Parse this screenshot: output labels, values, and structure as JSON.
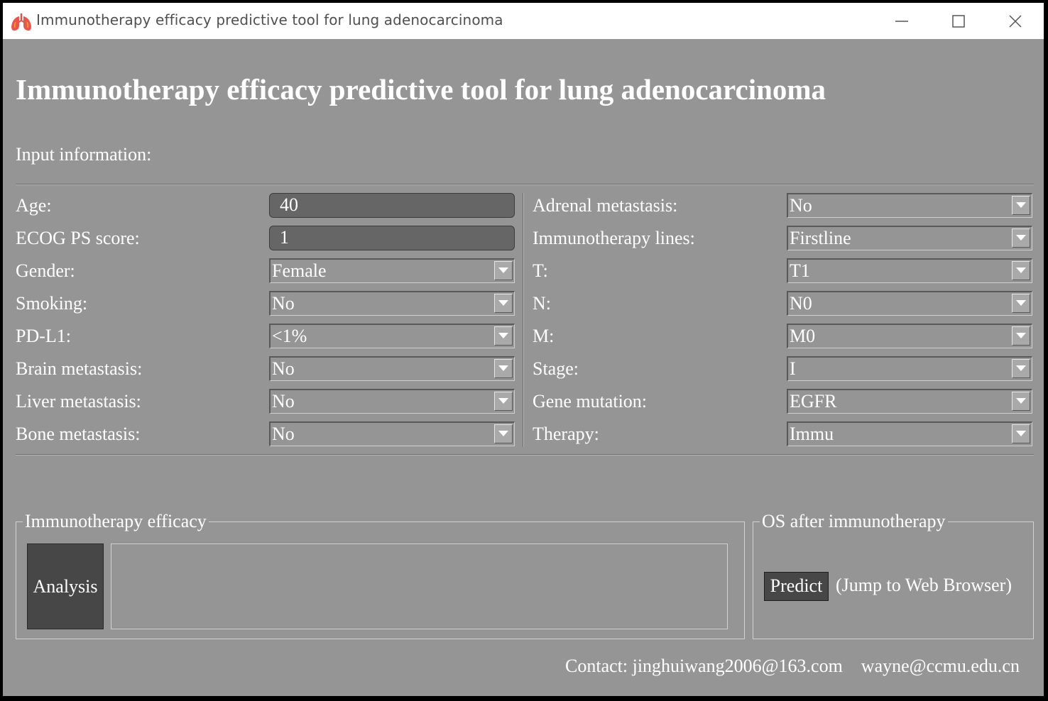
{
  "window": {
    "title": "Immunotherapy efficacy predictive tool for lung adenocarcinoma",
    "icon": "lungs-icon",
    "controls": [
      "minimize-icon",
      "maximize-icon",
      "close-icon"
    ]
  },
  "heading": "Immunotherapy efficacy predictive tool for lung adenocarcinoma",
  "input_section_label": "Input information:",
  "left_fields": [
    {
      "label": "Age:",
      "type": "entry",
      "value": "40"
    },
    {
      "label": "ECOG PS score:",
      "type": "entry",
      "value": "1"
    },
    {
      "label": "Gender:",
      "type": "combo",
      "value": "Female"
    },
    {
      "label": "Smoking:",
      "type": "combo",
      "value": "No"
    },
    {
      "label": "PD-L1:",
      "type": "combo",
      "value": "<1%"
    },
    {
      "label": "Brain metastasis:",
      "type": "combo",
      "value": "No"
    },
    {
      "label": "Liver metastasis:",
      "type": "combo",
      "value": "No"
    },
    {
      "label": "Bone metastasis:",
      "type": "combo",
      "value": "No"
    }
  ],
  "right_fields": [
    {
      "label": "Adrenal metastasis:",
      "type": "combo",
      "value": "No"
    },
    {
      "label": "Immunotherapy lines:",
      "type": "combo",
      "value": "Firstline"
    },
    {
      "label": "T:",
      "type": "combo",
      "value": "T1"
    },
    {
      "label": "N:",
      "type": "combo",
      "value": "N0"
    },
    {
      "label": "M:",
      "type": "combo",
      "value": "M0"
    },
    {
      "label": "Stage:",
      "type": "combo",
      "value": "I"
    },
    {
      "label": "Gene mutation:",
      "type": "combo",
      "value": "EGFR"
    },
    {
      "label": "Therapy:",
      "type": "combo",
      "value": "Immu"
    }
  ],
  "efficacy_group": {
    "title": "Immunotherapy efficacy",
    "button_label": "Analysis",
    "result_text": ""
  },
  "os_group": {
    "title": "OS after immunotherapy",
    "button_label": "Predict",
    "note": "(Jump to Web Browser)"
  },
  "contact": "Contact: jinghuiwang2006@163.com    wayne@ccmu.edu.cn",
  "colors": {
    "background": "#959595",
    "titlebar": "#ffffff",
    "entry_fill": "#666666",
    "button_fill": "#474747",
    "text": "#ffffff"
  }
}
